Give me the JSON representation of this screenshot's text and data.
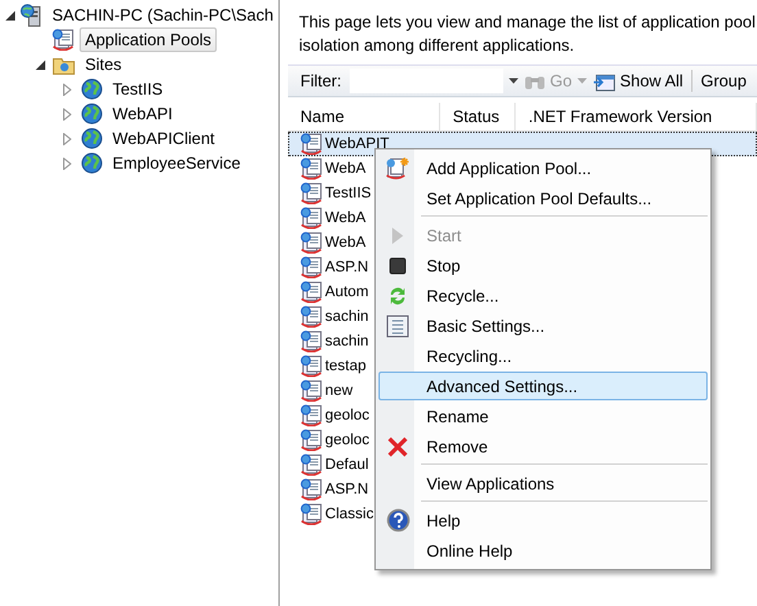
{
  "tree": [
    {
      "label": "SACHIN-PC (Sachin-PC\\Sach",
      "expanded": true,
      "selected": false,
      "children": [
        {
          "label": "Application Pools",
          "selected": true
        },
        {
          "label": "Sites",
          "expanded": true,
          "selected": false,
          "children": [
            {
              "label": "TestIIS",
              "expanded": false,
              "selected": false
            },
            {
              "label": "WebAPI",
              "expanded": false,
              "selected": false
            },
            {
              "label": "WebAPIClient",
              "expanded": false,
              "selected": false
            },
            {
              "label": "EmployeeService",
              "expanded": false,
              "selected": false
            }
          ]
        }
      ]
    }
  ],
  "description": "This page lets you view and manage the list of application pool\nisolation among different applications.",
  "toolbar": {
    "filter_label": "Filter:",
    "go": "Go",
    "show_all": "Show All",
    "group": "Group"
  },
  "table": {
    "columns": [
      "Name",
      "Status",
      ".NET Framework Version"
    ],
    "rows": [
      {
        "name": "WebAPIT",
        "selected": true
      },
      {
        "name": "WebA",
        "selected": false
      },
      {
        "name": "TestIIS",
        "selected": false
      },
      {
        "name": "WebA",
        "selected": false
      },
      {
        "name": "WebA",
        "selected": false
      },
      {
        "name": "ASP.N",
        "selected": false
      },
      {
        "name": "Autom",
        "selected": false
      },
      {
        "name": "sachin",
        "selected": false
      },
      {
        "name": "sachin",
        "selected": false
      },
      {
        "name": "testap",
        "selected": false
      },
      {
        "name": "new",
        "selected": false
      },
      {
        "name": "geoloc",
        "selected": false
      },
      {
        "name": "geoloc",
        "selected": false
      },
      {
        "name": "Defaul",
        "selected": false
      },
      {
        "name": "ASP.N",
        "selected": false
      },
      {
        "name": "Classic",
        "selected": false
      }
    ]
  },
  "context_menu": [
    {
      "kind": "item",
      "label": "Add Application Pool...",
      "disabled": false,
      "selected": false
    },
    {
      "kind": "item",
      "label": "Set Application Pool Defaults...",
      "disabled": false,
      "selected": false
    },
    {
      "kind": "separator"
    },
    {
      "kind": "item",
      "label": "Start",
      "disabled": true,
      "selected": false
    },
    {
      "kind": "item",
      "label": "Stop",
      "disabled": false,
      "selected": false
    },
    {
      "kind": "item",
      "label": "Recycle...",
      "disabled": false,
      "selected": false
    },
    {
      "kind": "item",
      "label": "Basic Settings...",
      "disabled": false,
      "selected": false
    },
    {
      "kind": "item",
      "label": "Recycling...",
      "disabled": false,
      "selected": false
    },
    {
      "kind": "item",
      "label": "Advanced Settings...",
      "disabled": false,
      "selected": true
    },
    {
      "kind": "item",
      "label": "Rename",
      "disabled": false,
      "selected": false
    },
    {
      "kind": "item",
      "label": "Remove",
      "disabled": false,
      "selected": false
    },
    {
      "kind": "separator"
    },
    {
      "kind": "item",
      "label": "View Applications",
      "disabled": false,
      "selected": false
    },
    {
      "kind": "separator"
    },
    {
      "kind": "item",
      "label": "Help",
      "disabled": false,
      "selected": false
    },
    {
      "kind": "item",
      "label": "Online Help",
      "disabled": false,
      "selected": false
    }
  ]
}
